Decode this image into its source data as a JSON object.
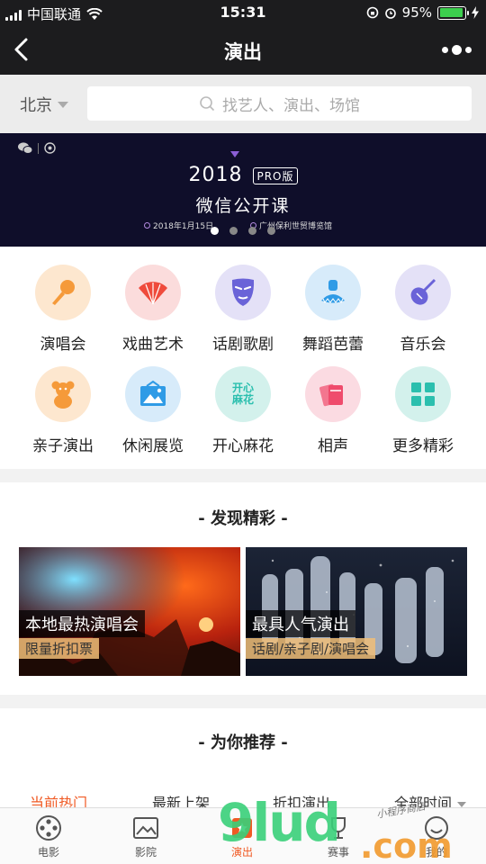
{
  "status_bar": {
    "carrier": "中国联通",
    "time": "15:31",
    "battery": "95%",
    "battery_level": 0.95
  },
  "nav": {
    "title": "演出"
  },
  "search": {
    "city": "北京",
    "placeholder": "找艺人、演出、场馆"
  },
  "banner": {
    "year": "2018",
    "badge": "PRO版",
    "headline": "微信公开课",
    "date": "2018年1月15日",
    "venue": "广州保利世贸博览馆",
    "slide_count": 4,
    "active_slide": 1
  },
  "categories": [
    {
      "label": "演唱会",
      "icon": "microphone-icon",
      "color": "#f59a3a",
      "bg": "#fde7cf"
    },
    {
      "label": "戏曲艺术",
      "icon": "fan-icon",
      "color": "#ef4b3c",
      "bg": "#fbdcdc"
    },
    {
      "label": "话剧歌剧",
      "icon": "mask-icon",
      "color": "#6a63d8",
      "bg": "#e4e1f7"
    },
    {
      "label": "舞蹈芭蕾",
      "icon": "tutu-dress-icon",
      "color": "#2f9be6",
      "bg": "#d7ebfa"
    },
    {
      "label": "音乐会",
      "icon": "violin-icon",
      "color": "#6a63d8",
      "bg": "#e4e1f7"
    },
    {
      "label": "亲子演出",
      "icon": "teddy-bear-icon",
      "color": "#f59a3a",
      "bg": "#fde7cf"
    },
    {
      "label": "休闲展览",
      "icon": "picture-frame-icon",
      "color": "#2f9be6",
      "bg": "#d7ebfa"
    },
    {
      "label": "开心麻花",
      "icon": "mahua-logo-icon",
      "color": "#2bbfae",
      "bg": "#d3f1ec",
      "icon_text": "开心\n麻花"
    },
    {
      "label": "相声",
      "icon": "tickets-icon",
      "color": "#ef4b6c",
      "bg": "#fbdbe2"
    },
    {
      "label": "更多精彩",
      "icon": "grid-icon",
      "color": "#2bbfae",
      "bg": "#d3f1ec"
    }
  ],
  "discover": {
    "title": "- 发现精彩 -",
    "cards": [
      {
        "title": "本地最热演唱会",
        "subtitle": "限量折扣票"
      },
      {
        "title": "最具人气演出",
        "subtitle": "话剧/亲子剧/演唱会"
      }
    ]
  },
  "recommend": {
    "title": "- 为你推荐 -",
    "tabs": [
      "当前热门",
      "最新上架",
      "折扣演出",
      "全部时间"
    ],
    "active_tab": 0
  },
  "tabbar": [
    {
      "label": "电影",
      "icon": "film-reel-icon"
    },
    {
      "label": "影院",
      "icon": "picture-icon"
    },
    {
      "label": "演出",
      "icon": "ticket-star-icon"
    },
    {
      "label": "赛事",
      "icon": "trophy-icon"
    },
    {
      "label": "我的",
      "icon": "smiley-icon"
    }
  ],
  "active_tabbar": 2,
  "watermark": {
    "main": "9lud",
    "suffix": ".com",
    "tag": "小程序商店"
  },
  "colors": {
    "accent": "#f05a24",
    "dark_bar": "#1c1c1e",
    "banner_bg": "#0f0e2a"
  }
}
